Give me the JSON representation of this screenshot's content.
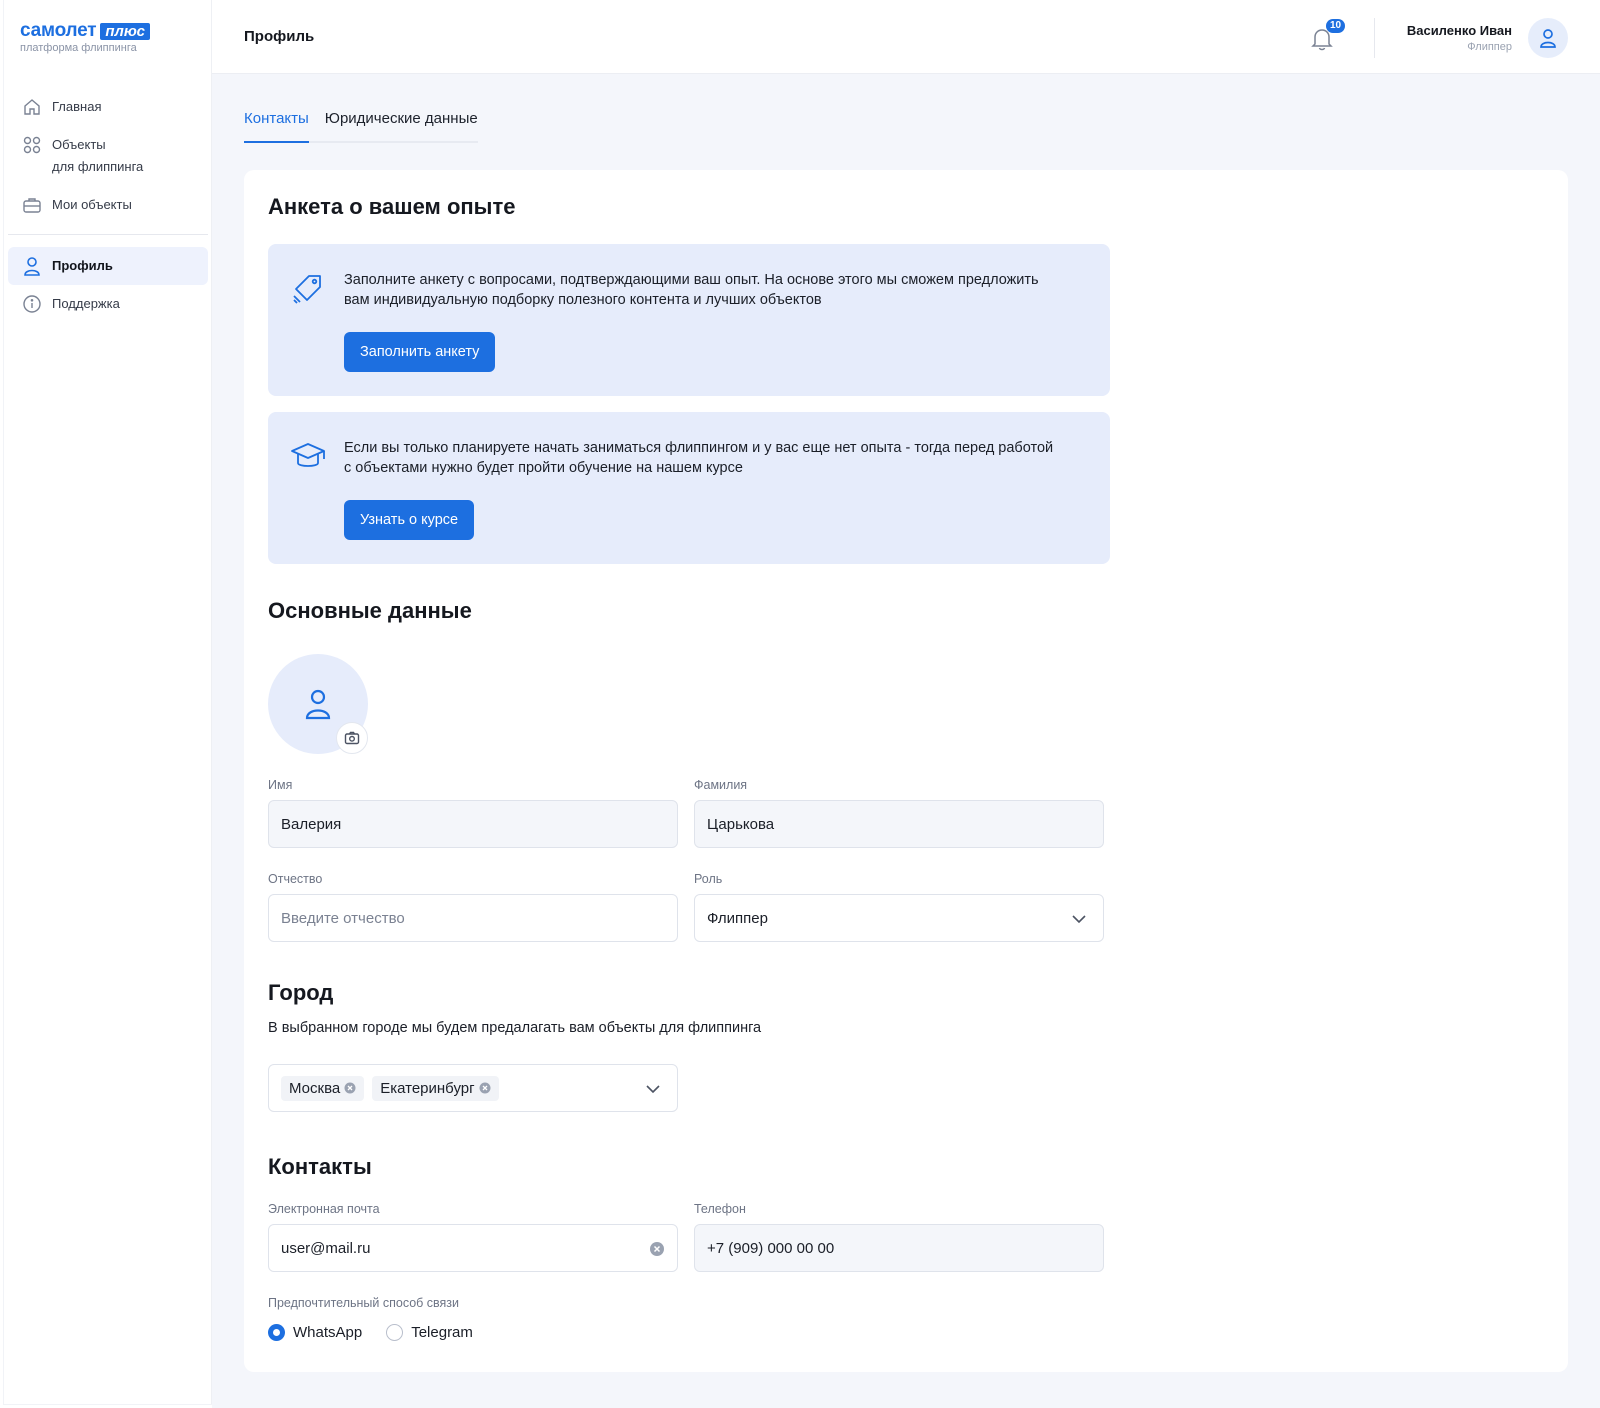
{
  "brand": {
    "name": "самолет",
    "badge": "плюс",
    "subtitle": "платформа флиппинга"
  },
  "sidebar": {
    "items": [
      {
        "label": "Главная",
        "icon": "home-icon"
      },
      {
        "label": "Объекты",
        "label2": "для флиппинга",
        "icon": "grid-icon"
      },
      {
        "label": "Мои объекты",
        "icon": "briefcase-icon"
      },
      {
        "label": "Профиль",
        "icon": "user-icon",
        "active": true
      },
      {
        "label": "Поддержка",
        "icon": "info-icon"
      }
    ]
  },
  "header": {
    "title": "Профиль",
    "notifications_count": "10",
    "user_name": "Василенко Иван",
    "user_role": "Флиппер"
  },
  "tabs": [
    {
      "label": "Контакты",
      "active": true
    },
    {
      "label": "Юридические данные",
      "active": false
    }
  ],
  "survey": {
    "title": "Анкета о вашем опыте",
    "box1_text": "Заполните анкету с вопросами, подтверждающими ваш опыт. На основе этого мы сможем предложить вам индивидуальную подборку полезного контента и лучших объектов",
    "box1_button": "Заполнить анкету",
    "box2_text": "Если вы только планируете начать заниматься флиппингом и у вас еще нет опыта - тогда перед работой с объектами нужно будет пройти обучение на нашем курсе",
    "box2_button": "Узнать о курсе"
  },
  "basic": {
    "title": "Основные данные",
    "first_name_label": "Имя",
    "first_name_value": "Валерия",
    "last_name_label": "Фамилия",
    "last_name_value": "Царькова",
    "patronymic_label": "Отчество",
    "patronymic_placeholder": "Введите отчество",
    "role_label": "Роль",
    "role_value": "Флиппер"
  },
  "city": {
    "title": "Город",
    "description": "В выбранном городе мы будем предалагать вам объекты для флиппинга",
    "selected": [
      "Москва",
      "Екатеринбург"
    ]
  },
  "contacts": {
    "title": "Контакты",
    "email_label": "Электронная почта",
    "email_value": "user@mail.ru",
    "phone_label": "Телефон",
    "phone_value": "+7 (909) 000 00 00",
    "preferred_label": "Предпочтительный способ связи",
    "options": [
      {
        "label": "WhatsApp",
        "selected": true
      },
      {
        "label": "Telegram",
        "selected": false
      }
    ]
  },
  "colors": {
    "accent": "#1d6fe0",
    "info_bg": "#e6ecfb",
    "page_bg": "#f4f6fb"
  }
}
